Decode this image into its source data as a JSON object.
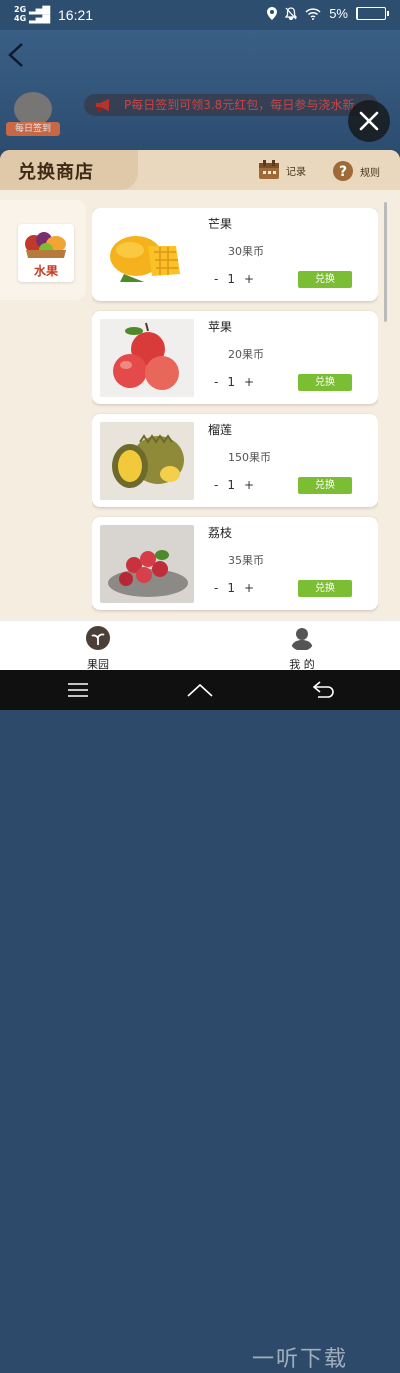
{
  "status_bar": {
    "network_top": "2G",
    "network_bottom": "4G",
    "time": "16:21",
    "battery": "5%",
    "battery_level": 0.05
  },
  "top": {
    "sign_label": "每日签到",
    "ticker_text": "P每日签到可领3.8元红包，每日参与浇水新"
  },
  "shop": {
    "title": "兑换商店",
    "records_label": "记录",
    "rules_label": "规则",
    "category": "水果",
    "items": [
      {
        "name": "芒果",
        "price": "30果币",
        "minus": "-",
        "qty": "1",
        "plus": "+",
        "button": "兑换"
      },
      {
        "name": "苹果",
        "price": "20果币",
        "minus": "-",
        "qty": "1",
        "plus": "+",
        "button": "兑换"
      },
      {
        "name": "榴莲",
        "price": "150果币",
        "minus": "-",
        "qty": "1",
        "plus": "+",
        "button": "兑换"
      },
      {
        "name": "荔枝",
        "price": "35果币",
        "minus": "-",
        "qty": "1",
        "plus": "+",
        "button": "兑换"
      }
    ]
  },
  "tabbar": {
    "orchard_label": "果园",
    "mine_label": "我 的"
  },
  "watermark": "一听下载",
  "colors": {
    "accent_green": "#7cbe33",
    "header_tan": "#e0c9a8",
    "category_red": "#c43b1f"
  }
}
